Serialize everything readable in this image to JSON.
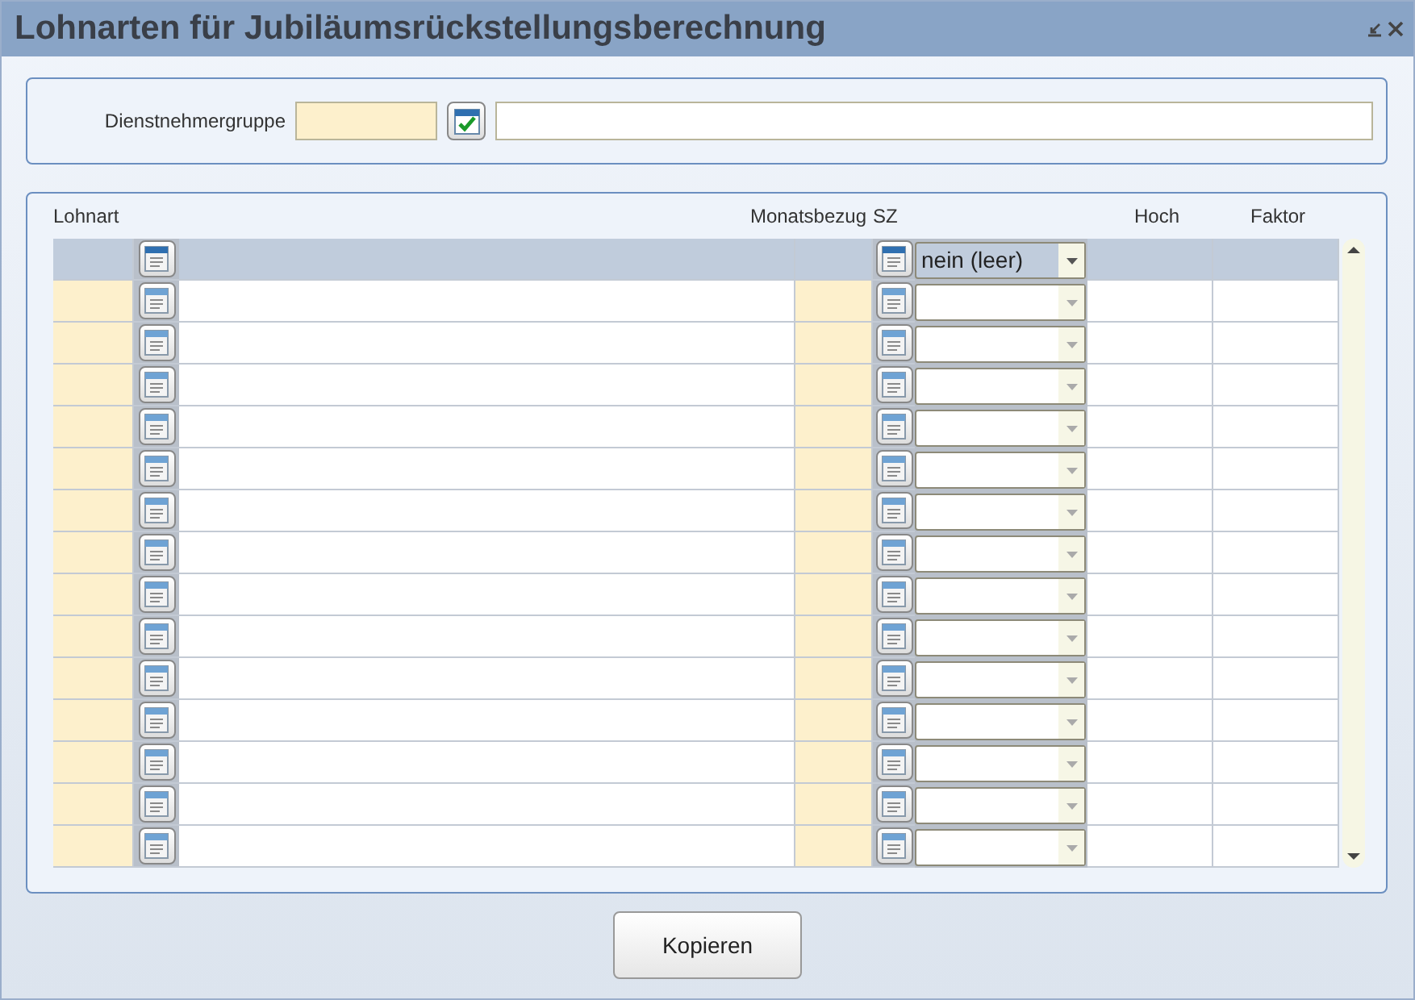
{
  "window": {
    "title": "Lohnarten für Jubiläumsrückstellungsberechnung"
  },
  "group": {
    "label": "Dienstnehmergruppe"
  },
  "table": {
    "columns": [
      "Lohnart",
      "Monatsbezug",
      "SZ",
      "Hoch",
      "Faktor"
    ],
    "rows": [
      {
        "selected": true,
        "sz": "nein (leer)"
      },
      {
        "selected": false
      },
      {
        "selected": false
      },
      {
        "selected": false
      },
      {
        "selected": false
      },
      {
        "selected": false
      },
      {
        "selected": false
      },
      {
        "selected": false
      },
      {
        "selected": false
      },
      {
        "selected": false
      },
      {
        "selected": false
      },
      {
        "selected": false
      },
      {
        "selected": false
      },
      {
        "selected": false
      },
      {
        "selected": false
      }
    ]
  },
  "buttons": [
    "Kopieren"
  ]
}
